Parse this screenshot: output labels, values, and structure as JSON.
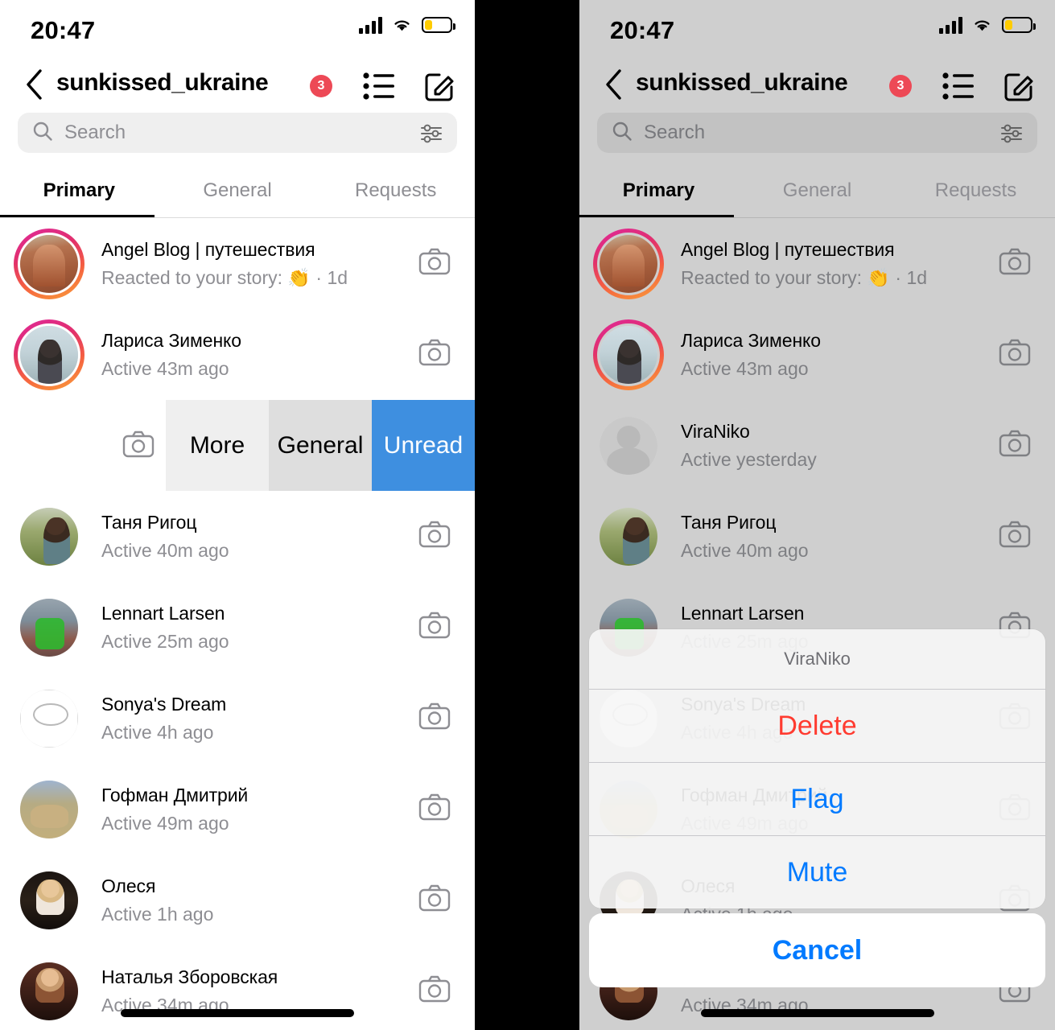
{
  "status_bar": {
    "time": "20:47",
    "cellular_icon": "signal-bars-icon",
    "wifi_icon": "wifi-icon",
    "battery_icon": "battery-low-icon"
  },
  "header": {
    "back_icon": "chevron-left-icon",
    "title": "sunkissed_ukraine",
    "badge_count": "3",
    "list_icon": "message-requests-list-icon",
    "compose_icon": "compose-new-message-icon"
  },
  "search": {
    "placeholder": "Search",
    "search_icon": "search-icon",
    "filter_icon": "filter-sliders-icon"
  },
  "tabs": [
    {
      "label": "Primary",
      "active": true
    },
    {
      "label": "General",
      "active": false
    },
    {
      "label": "Requests",
      "active": false
    }
  ],
  "colors": {
    "accent_blue": "#007AFF",
    "destructive_red": "#FF3B30",
    "badge_red": "#ED4956",
    "unread_blue": "#3E8FE0",
    "muted_text": "#8E8E93",
    "battery_yellow": "#FFCC00"
  },
  "left_panel": {
    "conversations": [
      {
        "name": "Angel Blog | путешествия",
        "status": "Reacted to your story: 👏 · 1d",
        "ring": true,
        "art": "art-church"
      },
      {
        "name": "Лариса Зименко",
        "status": "Active 43m ago",
        "ring": true,
        "art": "art-larisa"
      },
      {
        "name": "Таня Ригоц",
        "status": "Active 40m ago",
        "ring": false,
        "art": "art-tanya"
      },
      {
        "name": "Lennart Larsen",
        "status": "Active 25m ago",
        "ring": false,
        "art": "art-lennart"
      },
      {
        "name": "Sonya's Dream",
        "status": "Active 4h ago",
        "ring": false,
        "art": "art-sonya"
      },
      {
        "name": "Гофман Дмитрий",
        "status": "Active 49m ago",
        "ring": false,
        "art": "art-gofman"
      },
      {
        "name": "Олеся",
        "status": "Active 1h ago",
        "ring": false,
        "art": "art-olesya"
      },
      {
        "name": "Наталья Зборовская",
        "status": "Active 34m ago",
        "ring": false,
        "art": "art-natalia"
      }
    ],
    "swipe_actions": [
      {
        "label": "More",
        "style": "light"
      },
      {
        "label": "General",
        "style": "medium"
      },
      {
        "label": "Unread",
        "style": "blue"
      }
    ],
    "swipe_row_camera_icon": "camera-icon"
  },
  "right_panel": {
    "conversations": [
      {
        "name": "Angel Blog | путешествия",
        "status": "Reacted to your story: 👏 · 1d",
        "ring": true,
        "art": "art-church"
      },
      {
        "name": "Лариса Зименко",
        "status": "Active 43m ago",
        "ring": true,
        "art": "art-larisa"
      },
      {
        "name": "ViraNiko",
        "status": "Active yesterday",
        "ring": false,
        "art": "art-blank"
      },
      {
        "name": "Таня Ригоц",
        "status": "Active 40m ago",
        "ring": false,
        "art": "art-tanya"
      },
      {
        "name": "Lennart Larsen",
        "status": "Active 25m ago",
        "ring": false,
        "art": "art-lennart"
      },
      {
        "name": "Sonya's Dream",
        "status": "Active 4h ago",
        "ring": false,
        "art": "art-sonya"
      },
      {
        "name": "Гофман Дмитрий",
        "status": "Active 49m ago",
        "ring": false,
        "art": "art-gofman"
      },
      {
        "name": "Олеся",
        "status": "Active 1h ago",
        "ring": false,
        "art": "art-olesya"
      },
      {
        "name": "Наталья Зборовская",
        "status": "Active 34m ago",
        "ring": false,
        "art": "art-natalia"
      }
    ],
    "action_sheet": {
      "title": "ViraNiko",
      "options": [
        {
          "label": "Delete",
          "style": "destructive"
        },
        {
          "label": "Flag",
          "style": "default"
        },
        {
          "label": "Mute",
          "style": "default"
        }
      ],
      "cancel_label": "Cancel"
    }
  }
}
